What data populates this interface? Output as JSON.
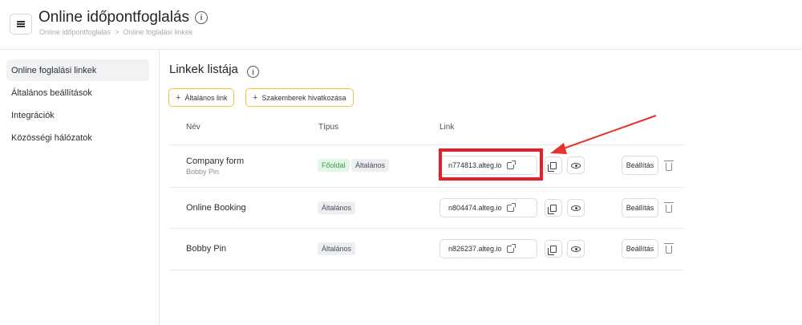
{
  "header": {
    "title": "Online időpontfoglalás",
    "breadcrumb": [
      "Online időpontfoglalás",
      "Online foglalási linkek"
    ],
    "breadcrumb_separator": ">"
  },
  "sidebar": {
    "items": [
      {
        "label": "Online foglalási linkek",
        "active": true
      },
      {
        "label": "Általános beállítások",
        "active": false
      },
      {
        "label": "Integrációk",
        "active": false
      },
      {
        "label": "Közösségi hálózatok",
        "active": false
      }
    ]
  },
  "main": {
    "title": "Linkek listája",
    "buttons": {
      "general_link": "Általános link",
      "specialist_link": "Szakemberek hivatkozása"
    },
    "columns": {
      "name": "Név",
      "type": "Típus",
      "link": "Link"
    },
    "rows": [
      {
        "name": "Company form",
        "sub": "Bobby Pin",
        "tags": [
          "Főoldal",
          "Általános"
        ],
        "link": "n774813.alteg.io",
        "settings": "Beállítás"
      },
      {
        "name": "Online Booking",
        "sub": "",
        "tags": [
          "Általános"
        ],
        "link": "n804474.alteg.io",
        "settings": "Beállítás"
      },
      {
        "name": "Bobby Pin",
        "sub": "",
        "tags": [
          "Általános"
        ],
        "link": "n826237.alteg.io",
        "settings": "Beállítás"
      }
    ]
  },
  "colors": {
    "accent_border": "#f0c23a",
    "highlight": "#e81d25",
    "tag_green_bg": "#e3f5e6",
    "tag_green_text": "#3f9a4f"
  },
  "icons": [
    "menu-icon",
    "info-icon",
    "plus-icon",
    "external-link-icon",
    "copy-icon",
    "eye-icon",
    "trash-icon"
  ]
}
